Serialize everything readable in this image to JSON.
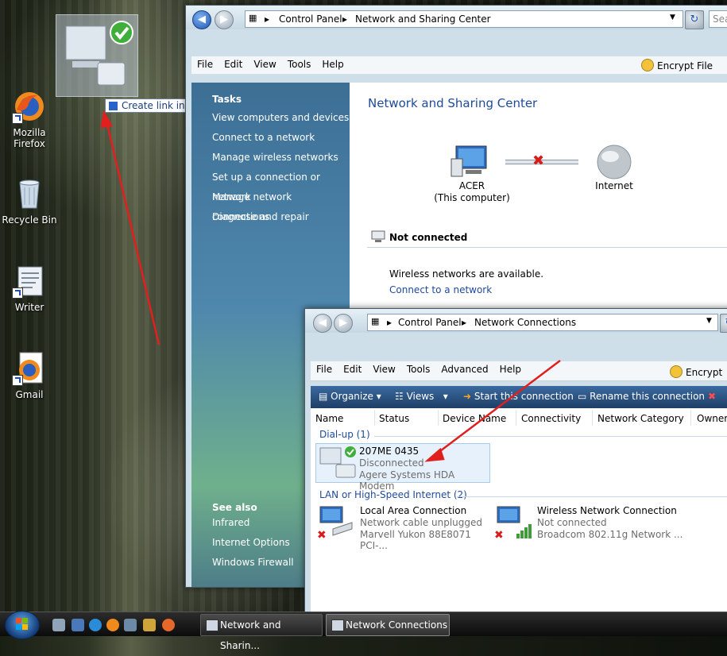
{
  "desktop": {
    "icons": [
      {
        "label": "Mozilla Firefox",
        "icon": "firefox-icon"
      },
      {
        "label": "Recycle Bin",
        "icon": "recycle-bin-icon"
      },
      {
        "label": "Writer",
        "icon": "writer-icon"
      },
      {
        "label": "Gmail",
        "icon": "firefox-icon"
      }
    ],
    "drag_tooltip": "Create link in Desktop"
  },
  "window1": {
    "breadcrumb": [
      "Control Panel",
      "Network and Sharing Center"
    ],
    "search_placeholder": "Sea",
    "menu": [
      "File",
      "Edit",
      "View",
      "Tools",
      "Help"
    ],
    "encrypt_label": "Encrypt File",
    "tasks_title": "Tasks",
    "tasks": [
      "View computers and devices",
      "Connect to a network",
      "Manage wireless networks",
      "Set up a connection or network",
      "Manage network connections",
      "Diagnose and repair"
    ],
    "see_also_title": "See also",
    "see_also": [
      "Infrared",
      "Internet Options",
      "Windows Firewall"
    ],
    "page_title": "Network and Sharing Center",
    "computer_name": "ACER",
    "computer_sub": "(This computer)",
    "internet_label": "Internet",
    "status_title": "Not connected",
    "wireless_msg": "Wireless networks are available.",
    "connect_link": "Connect to a network"
  },
  "window2": {
    "breadcrumb": [
      "Control Panel",
      "Network Connections"
    ],
    "menu": [
      "File",
      "Edit",
      "View",
      "Tools",
      "Advanced",
      "Help"
    ],
    "encrypt_label": "Encrypt",
    "toolbar": {
      "organize": "Organize",
      "views": "Views",
      "start": "Start this connection",
      "rename": "Rename this connection"
    },
    "columns": [
      "Name",
      "Status",
      "Device Name",
      "Connectivity",
      "Network Category",
      "Owner"
    ],
    "groups": [
      {
        "title": "Dial-up (1)"
      },
      {
        "title": "LAN or High-Speed Internet (2)"
      }
    ],
    "dialup": {
      "name": "207ME 0435",
      "status": "Disconnected",
      "device": "Agere Systems HDA Modem"
    },
    "lan": [
      {
        "name": "Local Area Connection",
        "status": "Network cable unplugged",
        "device": "Marvell Yukon 88E8071 PCI-..."
      },
      {
        "name": "Wireless Network Connection",
        "status": "Not connected",
        "device": "Broadcom 802.11g Network ..."
      }
    ]
  },
  "taskbar": {
    "tasks": [
      {
        "label": "Network and Sharin..."
      },
      {
        "label": "Network Connections"
      }
    ]
  },
  "colors": {
    "link": "#1e4a9c",
    "title": "#1e4a9c",
    "annotation": "#e11f1f",
    "error": "#d81b1b"
  }
}
